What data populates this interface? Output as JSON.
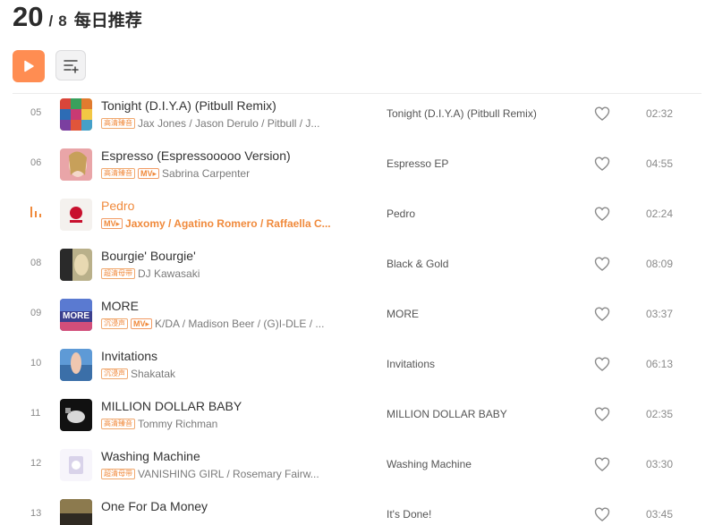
{
  "header": {
    "day": "20",
    "month": "8",
    "title": "每日推荐"
  },
  "accent": "#ff8d52",
  "toolbar": {
    "play_all_icon": "play-icon",
    "queue_icon": "add-to-queue-icon"
  },
  "songs": [
    {
      "num": "05",
      "title": "Tonight (D.I.Y.A) (Pitbull Remix)",
      "badges": [
        "高清臻音"
      ],
      "mv": false,
      "artists": "Jax Jones / Jason Derulo / Pitbull / J...",
      "album": "Tonight (D.I.Y.A) (Pitbull Remix)",
      "duration": "02:32",
      "playing": false
    },
    {
      "num": "06",
      "title": "Espresso (Espressooooo Version)",
      "badges": [
        "高清臻音"
      ],
      "mv": true,
      "artists": "Sabrina Carpenter",
      "album": "Espresso EP",
      "duration": "04:55",
      "playing": false
    },
    {
      "num": "",
      "title": "Pedro",
      "badges": [],
      "mv": true,
      "artists": "Jaxomy / Agatino Romero / Raffaella C...",
      "album": "Pedro",
      "duration": "02:24",
      "playing": true
    },
    {
      "num": "08",
      "title": "Bourgie' Bourgie'",
      "badges": [
        "超清母带"
      ],
      "mv": false,
      "artists": "DJ Kawasaki",
      "album": "Black & Gold",
      "duration": "08:09",
      "playing": false
    },
    {
      "num": "09",
      "title": "MORE",
      "badges": [
        "沉浸声"
      ],
      "mv": true,
      "artists": "K/DA / Madison Beer / (G)I-DLE / ...",
      "album": "MORE",
      "duration": "03:37",
      "playing": false
    },
    {
      "num": "10",
      "title": "Invitations",
      "badges": [
        "沉浸声"
      ],
      "mv": false,
      "artists": "Shakatak",
      "album": "Invitations",
      "duration": "06:13",
      "playing": false
    },
    {
      "num": "11",
      "title": "MILLION DOLLAR BABY",
      "badges": [
        "高清臻音"
      ],
      "mv": false,
      "artists": "Tommy Richman",
      "album": "MILLION DOLLAR BABY",
      "duration": "02:35",
      "playing": false
    },
    {
      "num": "12",
      "title": "Washing Machine",
      "badges": [
        "超清母带"
      ],
      "mv": false,
      "artists": "VANISHING GIRL / Rosemary Fairw...",
      "album": "Washing Machine",
      "duration": "03:30",
      "playing": false
    },
    {
      "num": "13",
      "title": "One For Da Money",
      "badges": [],
      "mv": false,
      "artists": "",
      "album": "It's Done!",
      "duration": "03:45",
      "playing": false
    }
  ]
}
